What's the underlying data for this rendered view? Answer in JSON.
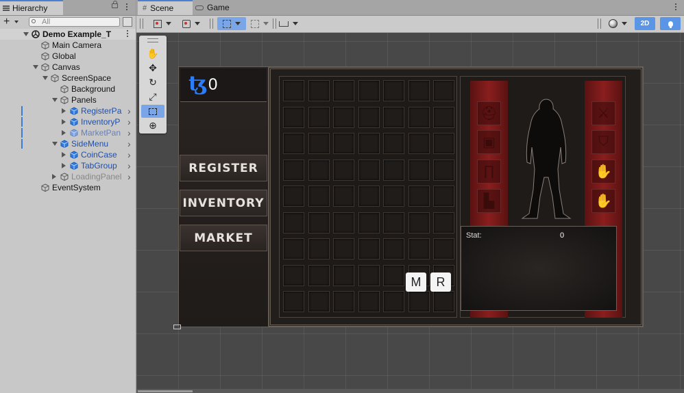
{
  "hierarchy": {
    "tab_label": "Hierarchy",
    "search_placeholder": "All",
    "add_label": "+",
    "scene_name": "Demo Example_T",
    "items": [
      {
        "label": "Main Camera"
      },
      {
        "label": "Global"
      },
      {
        "label": "Canvas"
      },
      {
        "label": "ScreenSpace"
      },
      {
        "label": "Background"
      },
      {
        "label": "Panels"
      },
      {
        "label": "RegisterPa"
      },
      {
        "label": "InventoryP"
      },
      {
        "label": "MarketPan"
      },
      {
        "label": "SideMenu"
      },
      {
        "label": "CoinCase"
      },
      {
        "label": "TabGroup"
      },
      {
        "label": "LoadingPanel"
      },
      {
        "label": "EventSystem"
      }
    ]
  },
  "scene_tabs": {
    "scene_label": "Scene",
    "game_label": "Game"
  },
  "scene_toolbar": {
    "mode_2d_label": "2D"
  },
  "game": {
    "coin_symbol": "ꜩ",
    "coin_count": "0",
    "menu": {
      "register_label": "REGISTER",
      "inventory_label": "INVENTORY",
      "market_label": "MARKET"
    },
    "inventory": {
      "grid_rows": 9,
      "grid_cols": 7,
      "m_button_label": "M",
      "r_button_label": "R"
    },
    "equipment": {
      "left_slots": [
        "helmet",
        "armor",
        "pants",
        "boots"
      ],
      "right_slots": [
        "weapon",
        "shield",
        "gloves-right",
        "gloves-left"
      ]
    },
    "stats": {
      "label": "Stat:",
      "value": "0"
    }
  }
}
